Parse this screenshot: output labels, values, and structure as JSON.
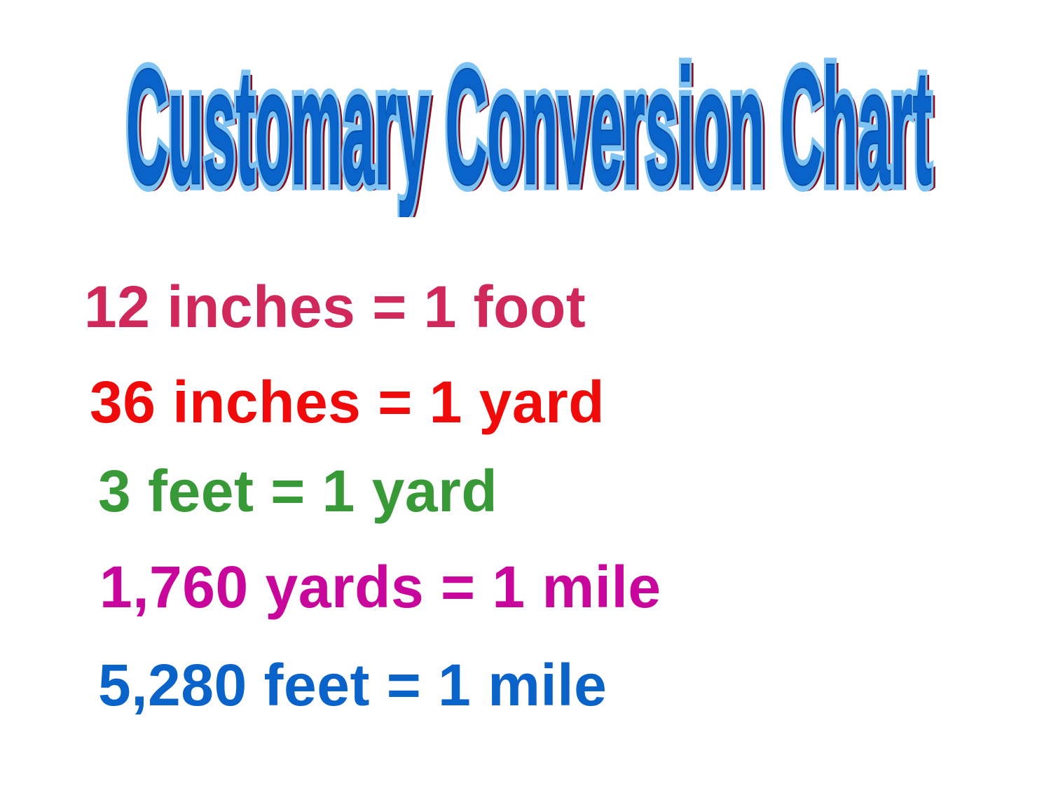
{
  "title": "Customary Conversion Chart",
  "colors": {
    "title_fill": "#0a63c9",
    "title_outline_light": "#7fc3f2",
    "title_shadow": "#8a0a1a"
  },
  "conversions": [
    {
      "text": "12 inches = 1 foot",
      "color": "#d0285a"
    },
    {
      "text": "36 inches = 1 yard",
      "color": "#f00a0a"
    },
    {
      "text": "3 feet = 1 yard",
      "color": "#379a36"
    },
    {
      "text": "1,760 yards = 1 mile",
      "color": "#c8069b"
    },
    {
      "text": "5,280 feet = 1 mile",
      "color": "#0a63c9"
    }
  ]
}
